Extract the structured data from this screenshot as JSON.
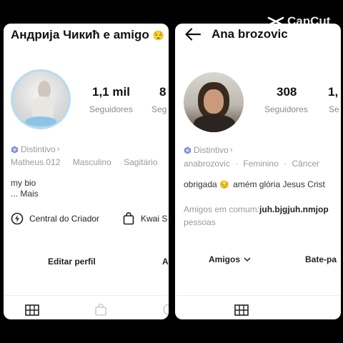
{
  "left": {
    "title": "Андрија Чикић е amigo",
    "title_emoji": "😌",
    "followers_count": "1,1 mil",
    "followers_label": "Seguidores",
    "following_count_partial": "8",
    "following_label_partial": "Seg",
    "badge_label": "Distintivo",
    "username": "Matheus.012",
    "gender": "Masculino",
    "sign": "Sagitário",
    "bio": "my bio",
    "bio_more": "...  Mais",
    "creator_center": "Central do Criador",
    "kwai_shop_partial": "Kwai S",
    "edit_profile": "Editar perfil",
    "second_button_partial": "A"
  },
  "right": {
    "title": "Ana brozovic",
    "followers_count": "308",
    "followers_label": "Seguidores",
    "following_count_partial": "1,",
    "following_label_partial": "Se",
    "badge_label": "Distintivo",
    "username": "anabrozovic",
    "gender": "Feminino",
    "sign": "Câncer",
    "bio_prefix": "obrigada",
    "bio_emoji": "😔",
    "bio_suffix": "amém glória Jesus Crist",
    "mutual_label": "Amigos em comum:",
    "mutual_names": "juh.bjgjuh.nmjop",
    "mutual_suffix": "pessoas",
    "friends_button": "Amigos",
    "batepapo_partial": "Bate-pa"
  },
  "watermark": "CapCut",
  "colors": {
    "background": "#000000",
    "panel": "#ffffff",
    "accent_badge": "#7c8ad8",
    "avatar_ring": "#b9daf0"
  }
}
